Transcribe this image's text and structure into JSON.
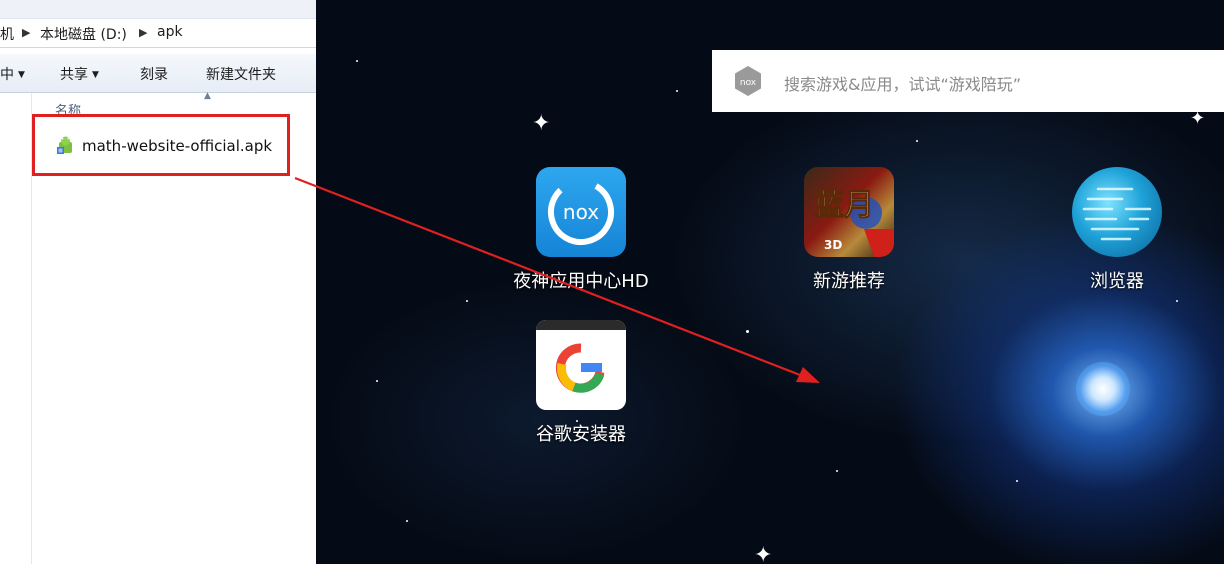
{
  "explorer": {
    "breadcrumb": [
      "机",
      "本地磁盘 (D:)",
      "apk"
    ],
    "toolbar": [
      "中",
      "共享",
      "刻录",
      "新建文件夹"
    ],
    "column_name": "名称",
    "file": {
      "name": "math-website-official.apk",
      "icon": "apk-file-icon"
    },
    "highlight_color": "#e02020"
  },
  "emulator": {
    "search_placeholder": "搜索游戏&应用，试试“游戏陪玩”",
    "search_logo": "nox",
    "apps": [
      {
        "label": "夜神应用中心HD",
        "icon": "nox-app-center-icon",
        "icon_text": "nox"
      },
      {
        "label": "新游推荐",
        "icon": "new-game-icon",
        "icon_text": "蓝月"
      },
      {
        "label": "浏览器",
        "icon": "browser-globe-icon"
      },
      {
        "label": "谷歌安装器",
        "icon": "google-installer-icon",
        "icon_text": "G"
      }
    ],
    "arrow_color": "#e02020"
  }
}
